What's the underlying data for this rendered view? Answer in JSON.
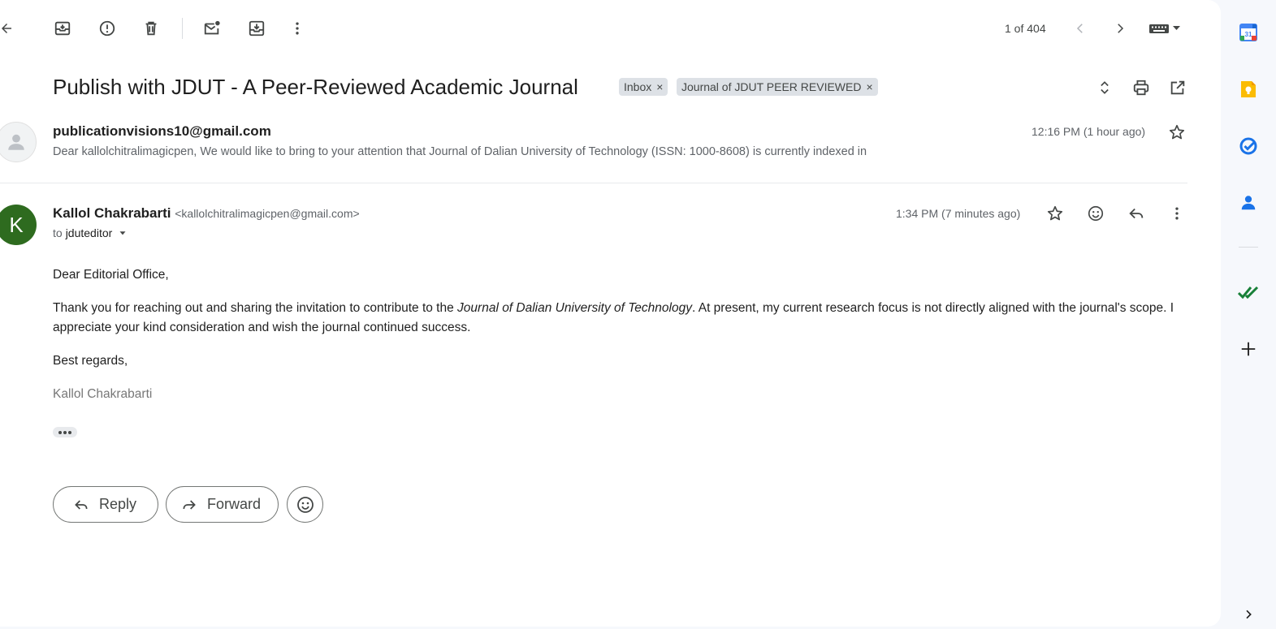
{
  "toolbar": {
    "back_icon": "arrow-left-icon",
    "archive_icon": "archive-icon",
    "report_spam_icon": "report-spam-icon",
    "delete_icon": "trash-icon",
    "mark_unread_icon": "mark-unread-icon",
    "move_to_icon": "move-to-icon",
    "more_icon": "more-vertical-icon",
    "pager_text": "1 of 404",
    "prev_icon": "chevron-left-icon",
    "next_icon": "chevron-right-icon",
    "input_tools_icon": "keyboard-icon"
  },
  "thread": {
    "subject": "Publish with JDUT - A Peer-Reviewed Academic Journal",
    "labels": [
      {
        "name": "Inbox",
        "remove": "×"
      },
      {
        "name": "Journal of JDUT PEER REVIEWED",
        "remove": "×"
      }
    ]
  },
  "messages": [
    {
      "sender_email": "publicationvisions10@gmail.com",
      "snippet": "Dear kallolchitralimagicpen, We would like to bring to your attention that Journal of Dalian University of Technology (ISSN: 1000-8608) is currently indexed in",
      "time": "12:16 PM (1 hour ago)"
    },
    {
      "avatar_letter": "K",
      "sender_name": "Kallol Chakrabarti",
      "sender_address": "<kallolchitralimagicpen@gmail.com>",
      "to_prefix": "to",
      "to": "jduteditor",
      "time": "1:34 PM (7 minutes ago)",
      "body": {
        "greeting": "Dear Editorial Office,",
        "p1_before": "Thank you for reaching out and sharing the invitation to contribute to the ",
        "p1_journal": "Journal of Dalian University of Technology",
        "p1_after": ". At present, my current research focus is not directly aligned with the journal's scope. I appreciate your kind consideration and wish the journal continued success.",
        "closing": "Best regards,",
        "signature": "Kallol Chakrabarti"
      }
    }
  ],
  "actions": {
    "reply_label": "Reply",
    "forward_label": "Forward"
  },
  "colors": {
    "avatar_k": "#2e6b1f",
    "label_chip": "#dde1e6",
    "app_background": "#f6f8fc"
  }
}
